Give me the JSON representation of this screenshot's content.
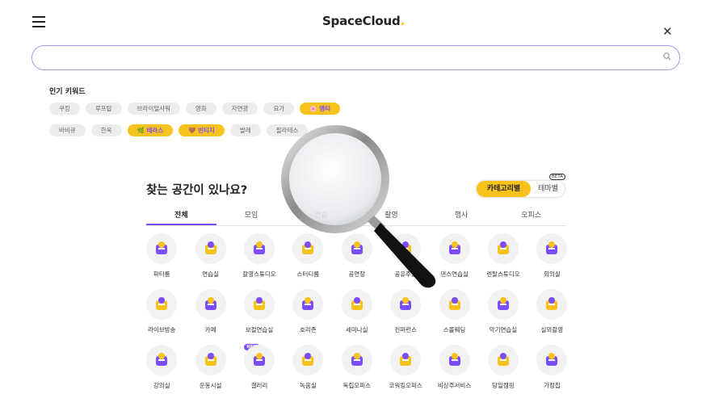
{
  "header": {
    "brand": "SpaceCloud",
    "brand_dot": "."
  },
  "search": {
    "placeholder": "",
    "value": ""
  },
  "keywords": {
    "title": "인기 키워드",
    "row1": [
      "쿠킹",
      "루프탑",
      "브라이덜샤워",
      "영화",
      "자연광",
      "요가",
      "🌸 엠티"
    ],
    "row2": [
      "바비큐",
      "한옥",
      "🌿 테라스",
      "🤎 빈티지",
      "발레",
      "필라테스"
    ],
    "highlighted": [
      "🌸 엠티",
      "🌿 테라스",
      "🤎 빈티지"
    ]
  },
  "finder": {
    "title": "찾는 공간이 있나요?",
    "toggle": {
      "category": "카테고리별",
      "theme": "테마별",
      "beta": "BETA"
    },
    "tabs": [
      "전체",
      "모임",
      "연습",
      "촬영",
      "행사",
      "오피스"
    ],
    "active_tab": "전체",
    "items": [
      {
        "label": "파티룸",
        "icon": "party-room-icon"
      },
      {
        "label": "연습실",
        "icon": "practice-room-icon"
      },
      {
        "label": "촬영스튜디오",
        "icon": "photo-studio-icon"
      },
      {
        "label": "스터디룸",
        "icon": "study-room-icon"
      },
      {
        "label": "공연장",
        "icon": "concert-hall-icon"
      },
      {
        "label": "공유주방",
        "icon": "shared-kitchen-icon"
      },
      {
        "label": "댄스연습실",
        "icon": "dance-studio-icon"
      },
      {
        "label": "렌탈스튜디오",
        "icon": "rental-studio-icon"
      },
      {
        "label": "회의실",
        "icon": "meeting-room-icon"
      },
      {
        "label": "라이브방송",
        "icon": "live-broadcast-icon"
      },
      {
        "label": "카페",
        "icon": "cafe-icon"
      },
      {
        "label": "보컬연습실",
        "icon": "vocal-room-icon"
      },
      {
        "label": "호리존",
        "icon": "horizon-studio-icon"
      },
      {
        "label": "세미나실",
        "icon": "seminar-room-icon"
      },
      {
        "label": "컨퍼런스",
        "icon": "conference-icon"
      },
      {
        "label": "스몰웨딩",
        "icon": "small-wedding-icon"
      },
      {
        "label": "악기연습실",
        "icon": "instrument-room-icon"
      },
      {
        "label": "실외촬영",
        "icon": "outdoor-shoot-icon"
      },
      {
        "label": "강의실",
        "icon": "lecture-room-icon"
      },
      {
        "label": "운동시설",
        "icon": "gym-icon",
        "badge": "NEW"
      },
      {
        "label": "갤러리",
        "icon": "gallery-icon"
      },
      {
        "label": "녹음실",
        "icon": "recording-studio-icon"
      },
      {
        "label": "독립오피스",
        "icon": "private-office-icon"
      },
      {
        "label": "코워킹오피스",
        "icon": "coworking-office-icon"
      },
      {
        "label": "비상주서비스",
        "icon": "virtual-office-icon"
      },
      {
        "label": "당일캠핑",
        "icon": "day-camping-icon"
      },
      {
        "label": "가정집",
        "icon": "house-icon"
      }
    ]
  },
  "colors": {
    "accent_purple": "#7c4dff",
    "accent_yellow": "#f7c21b",
    "chip_gray": "#ececec"
  }
}
